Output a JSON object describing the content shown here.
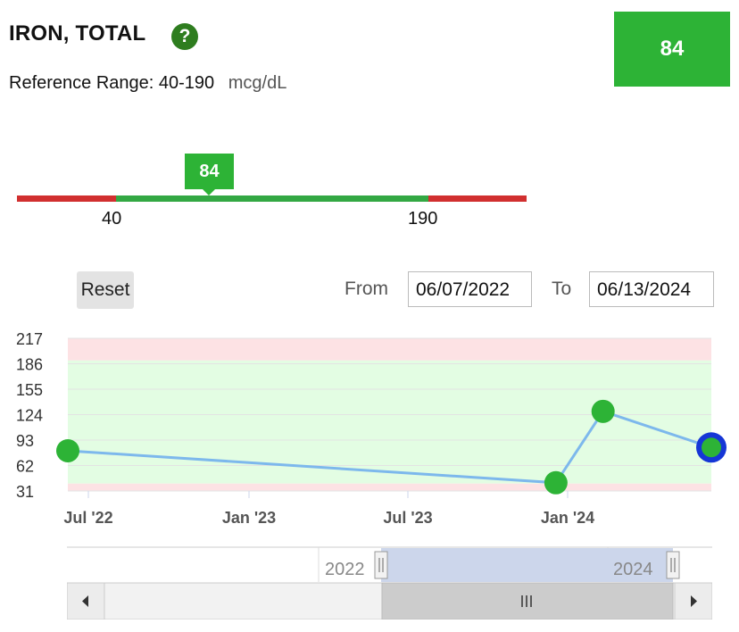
{
  "header": {
    "title": "IRON, TOTAL",
    "help_icon": "question-icon",
    "result_value": "84",
    "result_color": "#2db336"
  },
  "reference": {
    "label": "Reference Range:",
    "range": "40-190",
    "unit": "mcg/dL"
  },
  "range_bar": {
    "marker_value": "84",
    "low_label": "40",
    "high_label": "190",
    "low_color": "#d12f2f",
    "normal_color": "#33a843"
  },
  "controls": {
    "reset_label": "Reset",
    "from_label": "From",
    "from_value": "06/07/2022",
    "to_label": "To",
    "to_value": "06/13/2024"
  },
  "chart_data": {
    "type": "line",
    "y_ticks": [
      "217",
      "186",
      "155",
      "124",
      "93",
      "62",
      "31"
    ],
    "x_ticks": [
      "Jul '22",
      "Jan '23",
      "Jul '23",
      "Jan '24"
    ],
    "series": [
      {
        "x": [
          "2022-06-07",
          "2023-12-18",
          "2024-02-10",
          "2024-06-13"
        ],
        "y": [
          80,
          41,
          128,
          84
        ]
      }
    ],
    "bands": [
      {
        "from": 190,
        "to": 217,
        "color": "#fde2e4"
      },
      {
        "from": 40,
        "to": 190,
        "color": "#e3fde3"
      },
      {
        "from": 31,
        "to": 40,
        "color": "#fde2e4"
      }
    ],
    "ylim": [
      31,
      217
    ],
    "line_color": "#7db8ec",
    "point_color": "#2db336",
    "highlight_color": "#1536d6"
  },
  "navigator": {
    "left_year": "2022",
    "right_year": "2024",
    "scroll_left_icon": "triangle-left-icon",
    "scroll_right_icon": "triangle-right-icon",
    "grip_icon": "grip-lines-icon"
  }
}
